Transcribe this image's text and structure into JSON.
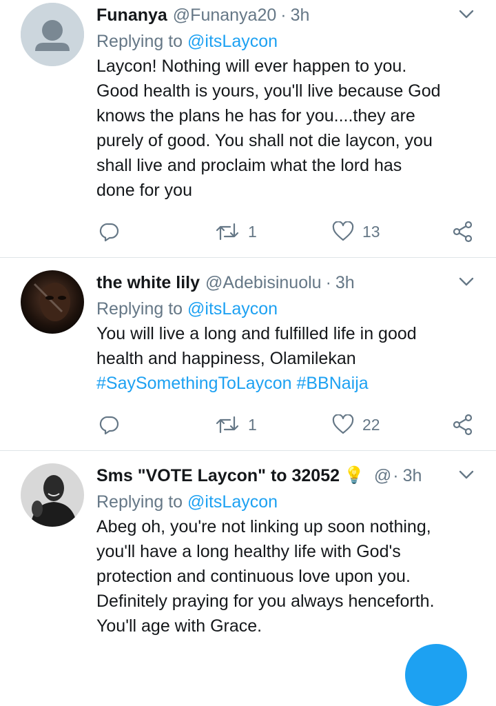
{
  "tweets": [
    {
      "name": "Funanya",
      "handle": "@Funanya20",
      "dot": "·",
      "time": "3h",
      "replying_prefix": "Replying to",
      "replying_to": "@itsLaycon",
      "lines": [
        "Laycon! Nothing will ever happen to you.",
        "Good health is yours, you'll live because God",
        "knows the plans he has for you....they are",
        "purely of good. You shall not die laycon, you",
        "shall live and proclaim what the lord has",
        "done for you"
      ],
      "retweets": "1",
      "likes": "13"
    },
    {
      "name": "the white lily",
      "handle": "@Adebisinuolu",
      "dot": "·",
      "time": "3h",
      "replying_prefix": "Replying to",
      "replying_to": "@itsLaycon",
      "lines": [
        "You will live a long and fulfilled life in good",
        "health and happiness, Olamilekan"
      ],
      "hashtags": "#SaySomethingToLaycon #BBNaija",
      "retweets": "1",
      "likes": "22"
    },
    {
      "name": "Sms \"VOTE Laycon\" to 32052",
      "emoji": "💡",
      "handle": "@",
      "dot": "·",
      "time": "3h",
      "replying_prefix": "Replying to",
      "replying_to": "@itsLaycon",
      "lines": [
        "Abeg oh, you're not linking up soon nothing,",
        "you'll have a long healthy life with God's",
        "protection and continuous love upon you.",
        "Definitely praying for you always henceforth.",
        "You'll age with Grace."
      ]
    }
  ],
  "colors": {
    "text": "#14171a",
    "secondary": "#657786",
    "link": "#1da1f2",
    "divider": "#dfe4e8"
  },
  "icons": [
    "default-avatar-icon",
    "chevron-down-icon",
    "reply-icon",
    "retweet-icon",
    "like-icon",
    "share-icon"
  ]
}
